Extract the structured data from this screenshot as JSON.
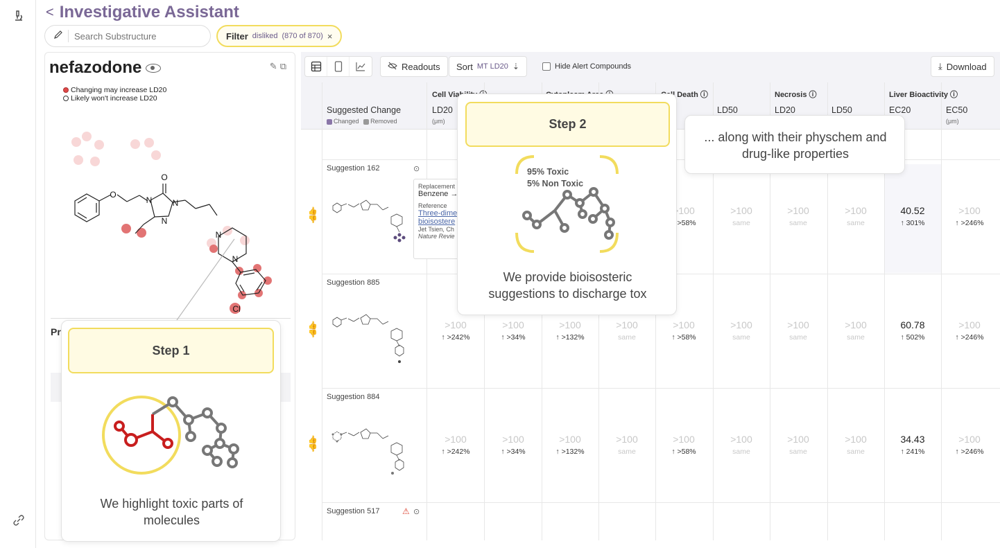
{
  "app": {
    "title": "Investigative Assistant",
    "back_icon": "chevron-left-icon"
  },
  "search": {
    "placeholder": "Search Substructure"
  },
  "filter": {
    "label": "Filter",
    "value": "disliked",
    "count": "(870 of 870)",
    "clear": "×"
  },
  "molecule": {
    "name": "nefazodone",
    "legend_increase": "Changing may increase LD20",
    "legend_wont": "Likely won't increase LD20",
    "atom_labels": [
      "O",
      "N",
      "N",
      "N",
      "N",
      "N",
      "Cl"
    ],
    "section_label": "Pr"
  },
  "toolbar": {
    "readouts": "Readouts",
    "sort_label": "Sort",
    "sort_value": "MT LD20",
    "hide_alert": "Hide Alert Compounds",
    "download": "Download"
  },
  "table": {
    "suggested_change": "Suggested Change",
    "legend_changed": "Changed",
    "legend_removed": "Removed",
    "groups": [
      "Cell Viability",
      "Cytoplasm Area",
      "Cell Death",
      "Necrosis",
      "Liver Bioactivity"
    ],
    "columns": [
      "LD20",
      "LD50",
      "LD20",
      "LD50",
      "LD20",
      "LD50",
      "LD20",
      "LD50",
      "EC20",
      "EC50"
    ],
    "unit": "(μm)",
    "rows": [
      {
        "label": "Suggestion 162",
        "cells": [
          {
            "v": "",
            "d": ""
          },
          {
            "v": "",
            "d": ""
          },
          {
            "v": "",
            "d": ""
          },
          {
            "v": "",
            "d": ""
          },
          {
            "v": ">100",
            "d": "↑ >58%"
          },
          {
            "v": ">100",
            "d": "same"
          },
          {
            "v": ">100",
            "d": "same"
          },
          {
            "v": ">100",
            "d": "same"
          },
          {
            "v": "40.52",
            "d": "↑ 301%"
          },
          {
            "v": ">100",
            "d": "↑ >246%"
          }
        ]
      },
      {
        "label": "Suggestion 885",
        "cells": [
          {
            "v": ">100",
            "d": "↑ >242%"
          },
          {
            "v": ">100",
            "d": "↑ >34%"
          },
          {
            "v": ">100",
            "d": "↑ >132%"
          },
          {
            "v": ">100",
            "d": "same"
          },
          {
            "v": ">100",
            "d": "↑ >58%"
          },
          {
            "v": ">100",
            "d": "same"
          },
          {
            "v": ">100",
            "d": "same"
          },
          {
            "v": ">100",
            "d": "same"
          },
          {
            "v": "60.78",
            "d": "↑ 502%"
          },
          {
            "v": ">100",
            "d": "↑ >246%"
          }
        ]
      },
      {
        "label": "Suggestion 884",
        "cells": [
          {
            "v": ">100",
            "d": "↑ >242%"
          },
          {
            "v": ">100",
            "d": "↑ >34%"
          },
          {
            "v": ">100",
            "d": "↑ >132%"
          },
          {
            "v": ">100",
            "d": "same"
          },
          {
            "v": ">100",
            "d": "↑ >58%"
          },
          {
            "v": ">100",
            "d": "same"
          },
          {
            "v": ">100",
            "d": "same"
          },
          {
            "v": ">100",
            "d": "same"
          },
          {
            "v": "34.43",
            "d": "↑ 241%"
          },
          {
            "v": ">100",
            "d": "↑ >246%"
          }
        ]
      },
      {
        "label": "Suggestion 517",
        "cells": []
      }
    ]
  },
  "reference": {
    "replacement_label": "Replacement",
    "replacement_value": "Benzene →",
    "reference_label": "Reference",
    "link_line1": "Three-dime",
    "link_line2": "bioisostere",
    "authors": "Jet Tsien, Ch",
    "journal": "Nature Revie"
  },
  "overlays": {
    "step1_title": "Step 1",
    "step1_text": "We highlight toxic parts of molecules",
    "step2_title": "Step 2",
    "step2_toxic": "95% Toxic",
    "step2_nontoxic": "5% Non Toxic",
    "step2_text": "We provide bioisosteric suggestions to discharge tox",
    "step3_text": "... along with their physchem and drug-like properties"
  },
  "colors": {
    "accent": "#7a6896",
    "highlight_yellow": "#f2dc5d",
    "toxic_red": "#c81e1e",
    "atom_highlight": "#e57373"
  }
}
